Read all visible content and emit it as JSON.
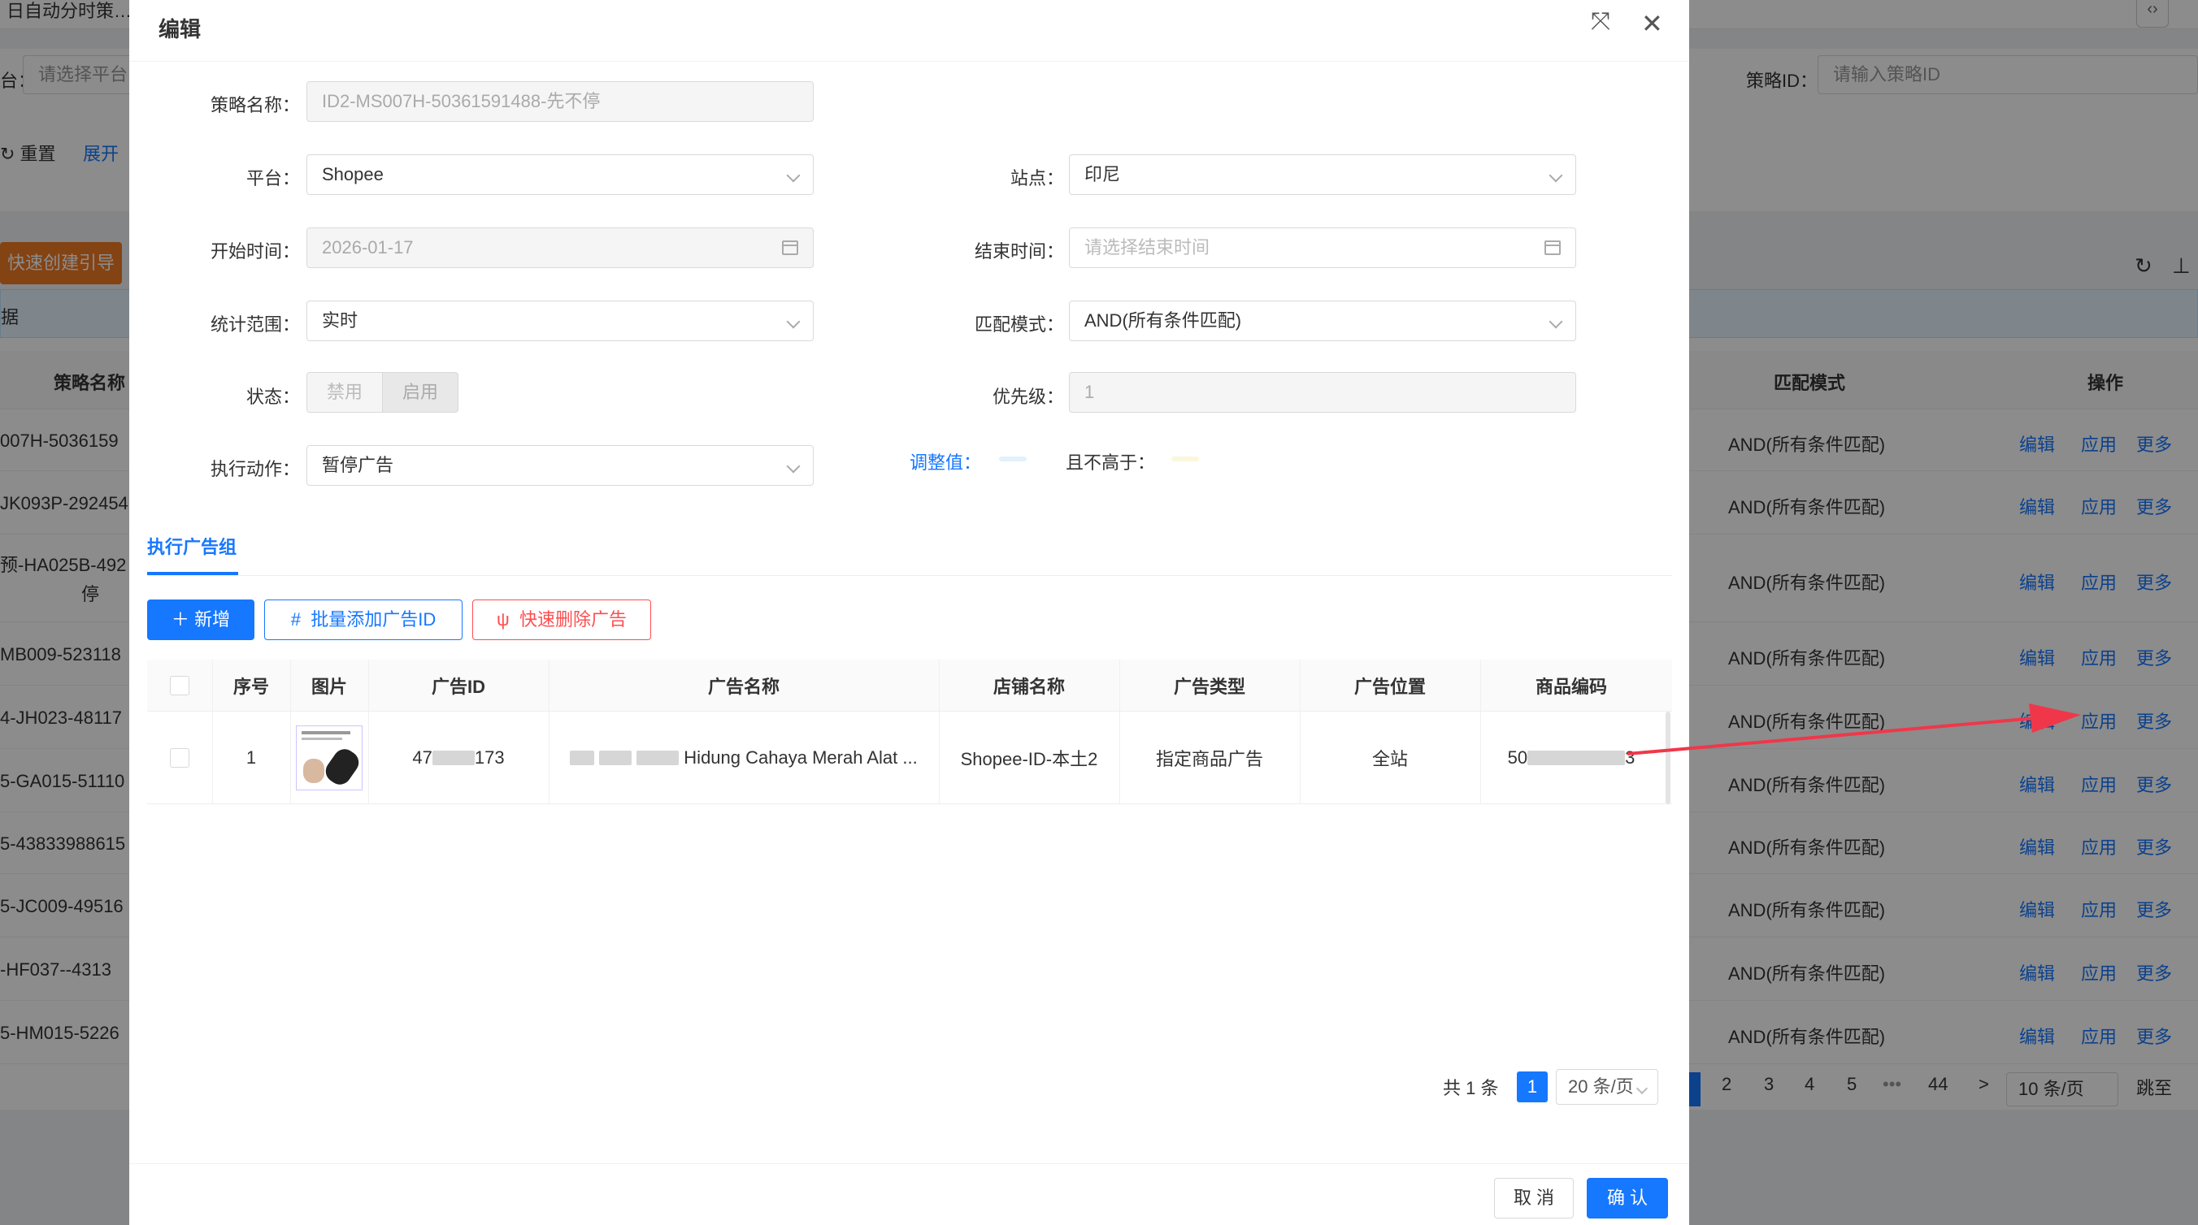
{
  "background": {
    "title": "日自动分时策…",
    "filter": {
      "platform_label": "台：",
      "platform_placeholder": "请选择平台",
      "strategy_id_label": "策略ID：",
      "strategy_id_placeholder": "请输入策略ID",
      "reset": "重置",
      "expand": "展开"
    },
    "quick_create": "快速创建引导",
    "bar_text": "据",
    "columns": {
      "name": "策略名称",
      "mode": "匹配模式",
      "ops": "操作"
    },
    "rows": [
      {
        "name": "007H-5036159",
        "mode": "AND(所有条件匹配)"
      },
      {
        "name": "JK093P-292454",
        "mode": "AND(所有条件匹配)"
      },
      {
        "name": "预-HA025B-492",
        "name2": "停",
        "mode": "AND(所有条件匹配)"
      },
      {
        "name": "MB009-523118",
        "mode": "AND(所有条件匹配)"
      },
      {
        "name": "4-JH023-48117",
        "mode": "AND(所有条件匹配)"
      },
      {
        "name": "5-GA015-51110",
        "mode": "AND(所有条件匹配)"
      },
      {
        "name": "5-43833988615",
        "mode": "AND(所有条件匹配)"
      },
      {
        "name": "5-JC009-49516",
        "mode": "AND(所有条件匹配)"
      },
      {
        "name": "-HF037--4313",
        "mode": "AND(所有条件匹配)"
      },
      {
        "name": "5-HM015-5226",
        "mode": "AND(所有条件匹配)"
      }
    ],
    "row_ops": {
      "edit": "编辑",
      "apply": "应用",
      "more": "更多"
    },
    "pager": {
      "pages": [
        "2",
        "3",
        "4",
        "5",
        "•••",
        "44"
      ],
      "next": ">",
      "size": "10 条/页",
      "jump": "跳至"
    }
  },
  "modal": {
    "title": "编辑",
    "form": {
      "strategy_name_label": "策略名称：",
      "strategy_name_value": "ID2-MS007H-50361591488-先不停",
      "platform_label": "平台：",
      "platform_value": "Shopee",
      "site_label": "站点：",
      "site_value": "印尼",
      "start_time_label": "开始时间：",
      "start_time_value": "2026-01-17",
      "end_time_label": "结束时间：",
      "end_time_placeholder": "请选择结束时间",
      "stat_range_label": "统计范围：",
      "stat_range_value": "实时",
      "match_mode_label": "匹配模式：",
      "match_mode_value": "AND(所有条件匹配)",
      "status_label": "状态：",
      "status_disabled": "禁用",
      "status_enabled": "启用",
      "priority_label": "优先级：",
      "priority_value": "1",
      "action_label": "执行动作：",
      "action_value": "暂停广告",
      "adjust_label": "调整值：",
      "cap_label": "且不高于："
    },
    "tab": "执行广告组",
    "buttons": {
      "add": "新增",
      "batch_add": "批量添加广告ID",
      "quick_delete": "快速删除广告"
    },
    "table": {
      "headers": [
        "序号",
        "图片",
        "广告ID",
        "广告名称",
        "店铺名称",
        "广告类型",
        "广告位置",
        "商品编码"
      ],
      "rows": [
        {
          "index": "1",
          "ad_id_prefix": "47",
          "ad_id_suffix": "173",
          "ad_name": "Hidung Cahaya Merah Alat ...",
          "shop": "Shopee-ID-本土2",
          "ad_type": "指定商品广告",
          "position": "全站",
          "sku_prefix": "50",
          "sku_suffix": "3"
        }
      ]
    },
    "pager": {
      "total": "共 1 条",
      "current": "1",
      "size": "20 条/页"
    },
    "footer": {
      "cancel": "取 消",
      "ok": "确 认"
    }
  },
  "colors": {
    "primary": "#1677ff",
    "danger": "#ff4d4f",
    "annotation": "#f0374a",
    "orange": "#f07b24"
  }
}
